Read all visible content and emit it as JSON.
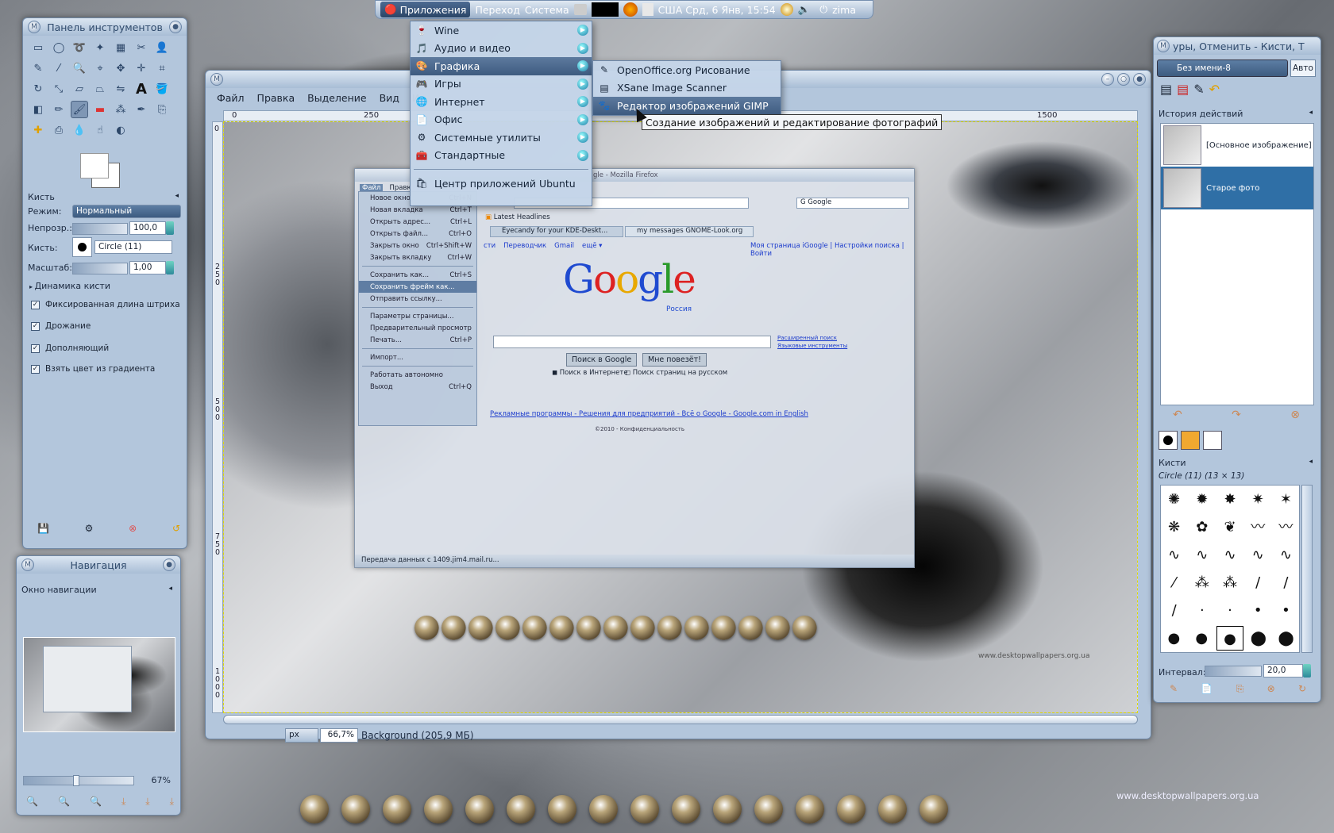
{
  "top_panel": {
    "apps": "Приложения",
    "places": "Переход",
    "system": "Система",
    "clock": "США Срд,  6 Янв, 15:54",
    "user": "zima"
  },
  "apps_menu": {
    "items": [
      {
        "label": "Wine",
        "icon": "🍷",
        "arrow": true
      },
      {
        "label": "Аудио и видео",
        "icon": "🎵",
        "arrow": true
      },
      {
        "label": "Графика",
        "icon": "🎨",
        "arrow": true,
        "hl": true
      },
      {
        "label": "Игры",
        "icon": "🎮",
        "arrow": true
      },
      {
        "label": "Интернет",
        "icon": "🌐",
        "arrow": true
      },
      {
        "label": "Офис",
        "icon": "📄",
        "arrow": true
      },
      {
        "label": "Системные утилиты",
        "icon": "⚙",
        "arrow": true
      },
      {
        "label": "Стандартные",
        "icon": "🧰",
        "arrow": true
      }
    ],
    "center": "Центр приложений Ubuntu"
  },
  "graphics_submenu": {
    "items": [
      "OpenOffice.org Рисование",
      "XSane Image Scanner",
      "Редактор изображений GIMP"
    ],
    "tooltip": "Создание изображений и редактирование фотографий"
  },
  "toolbox": {
    "title": "Панель инструментов",
    "brush_section": "Кисть",
    "mode_label": "Режим:",
    "mode_value": "Нормальный",
    "opacity_label": "Непрозр.:",
    "opacity_value": "100,0",
    "brush_label": "Кисть:",
    "brush_value": "Circle (11)",
    "scale_label": "Масштаб:",
    "scale_value": "1,00",
    "dynamics": "Динамика кисти",
    "opt1": "Фиксированная длина штриха",
    "opt2": "Дрожание",
    "opt3": "Дополняющий",
    "opt4": "Взять цвет из градиента"
  },
  "navigation": {
    "title": "Навигация",
    "subtitle": "Окно навигации",
    "zoom": "67%"
  },
  "image_window": {
    "menu": [
      "Файл",
      "Правка",
      "Выделение",
      "Вид",
      "И"
    ],
    "ruler_ticks": [
      "0",
      "250",
      "1500"
    ],
    "unit": "px",
    "zoom": "66,7%",
    "status": "Background (205,9 МБ)",
    "vruler": [
      "0",
      "250",
      "500",
      "750",
      "1000"
    ]
  },
  "right_dock": {
    "title": "уры, Отменить - Кисти, Т",
    "image_select": "Без имени-8",
    "auto": "Авто",
    "history_title": "История действий",
    "history": [
      "[Основное изображение]",
      "Старое фото"
    ],
    "brushes_title": "Кисти",
    "brush_name": "Circle (11) (13 × 13)",
    "interval_label": "Интервал:",
    "interval_value": "20,0"
  },
  "firefox": {
    "title": "gle - Mozilla Firefox",
    "file_menu": "Файл",
    "edit_menu": "Правк",
    "search_engine": "Google",
    "bookmark": "Latest Headlines",
    "tab1": "Eyecandy for your KDE-Deskt...",
    "tab2": "my messages GNOME-Look.org",
    "links_left": [
      "сти",
      "Переводчик",
      "Gmail",
      "ещё ▾"
    ],
    "links_right": "Моя страница iGoogle | Настройки поиска | Войти",
    "logo_sub": "Россия",
    "adv1": "Расширенный поиск",
    "adv2": "Языковые инструменты",
    "btn1": "Поиск в Google",
    "btn2": "Мне повезёт!",
    "radio1": "Поиск в Интернете",
    "radio2": "Поиск страниц на русском",
    "footer": "Рекламные программы - Решения для предприятий - Всё о Google - Google.com in English",
    "copyright": "©2010 - Конфиденциальность",
    "status": "Передача данных с 1409.jim4.mail.ru...",
    "menu_items": [
      [
        "Новое окно",
        "Ctrl+N"
      ],
      [
        "Новая вкладка",
        "Ctrl+T"
      ],
      [
        "Открыть адрес...",
        "Ctrl+L"
      ],
      [
        "Открыть файл...",
        "Ctrl+O"
      ],
      [
        "Закрыть окно",
        "Ctrl+Shift+W"
      ],
      [
        "Закрыть вкладку",
        "Ctrl+W"
      ],
      [
        "",
        ""
      ],
      [
        "Сохранить как...",
        "Ctrl+S"
      ],
      [
        "Сохранить фрейм как...",
        ""
      ],
      [
        "Отправить ссылку...",
        ""
      ],
      [
        "",
        ""
      ],
      [
        "Параметры страницы...",
        ""
      ],
      [
        "Предварительный просмотр",
        ""
      ],
      [
        "Печать...",
        "Ctrl+P"
      ],
      [
        "",
        ""
      ],
      [
        "Импорт...",
        ""
      ],
      [
        "",
        ""
      ],
      [
        "Работать автономно",
        ""
      ],
      [
        "Выход",
        "Ctrl+Q"
      ]
    ]
  },
  "watermark": "www.desktopwallpapers.org.ua"
}
